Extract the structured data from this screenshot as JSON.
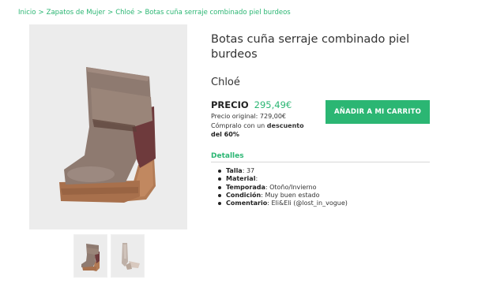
{
  "breadcrumb": {
    "items": [
      "Inicio",
      "Zapatos de Mujer",
      "Chloé",
      "Botas cuña serraje combinado piel burdeos"
    ],
    "separator": ">"
  },
  "product": {
    "title": "Botas cuña serraje combinado piel burdeos",
    "brand": "Chloé",
    "price_label": "PRECIO",
    "price": "295,49€",
    "original_price_text": "Precio original: 729,00€",
    "discount_prefix": "Cómpralo con un ",
    "discount_word": "descuento",
    "discount_amount": "del 60%",
    "add_to_cart_label": "AÑADIR A MI CARRITO"
  },
  "details": {
    "title": "Detalles",
    "items": [
      {
        "key": "Talla",
        "value": ": 37"
      },
      {
        "key": "Material",
        "value": ":"
      },
      {
        "key": "Temporada",
        "value": ": Otoño/Invierno"
      },
      {
        "key": "Condición",
        "value": ": Muy buen estado"
      },
      {
        "key": "Comentario",
        "value": ": Eli&Eli (@lost_in_vogue)"
      }
    ]
  },
  "colors": {
    "accent": "#2bb673",
    "image_bg": "#ececec"
  }
}
